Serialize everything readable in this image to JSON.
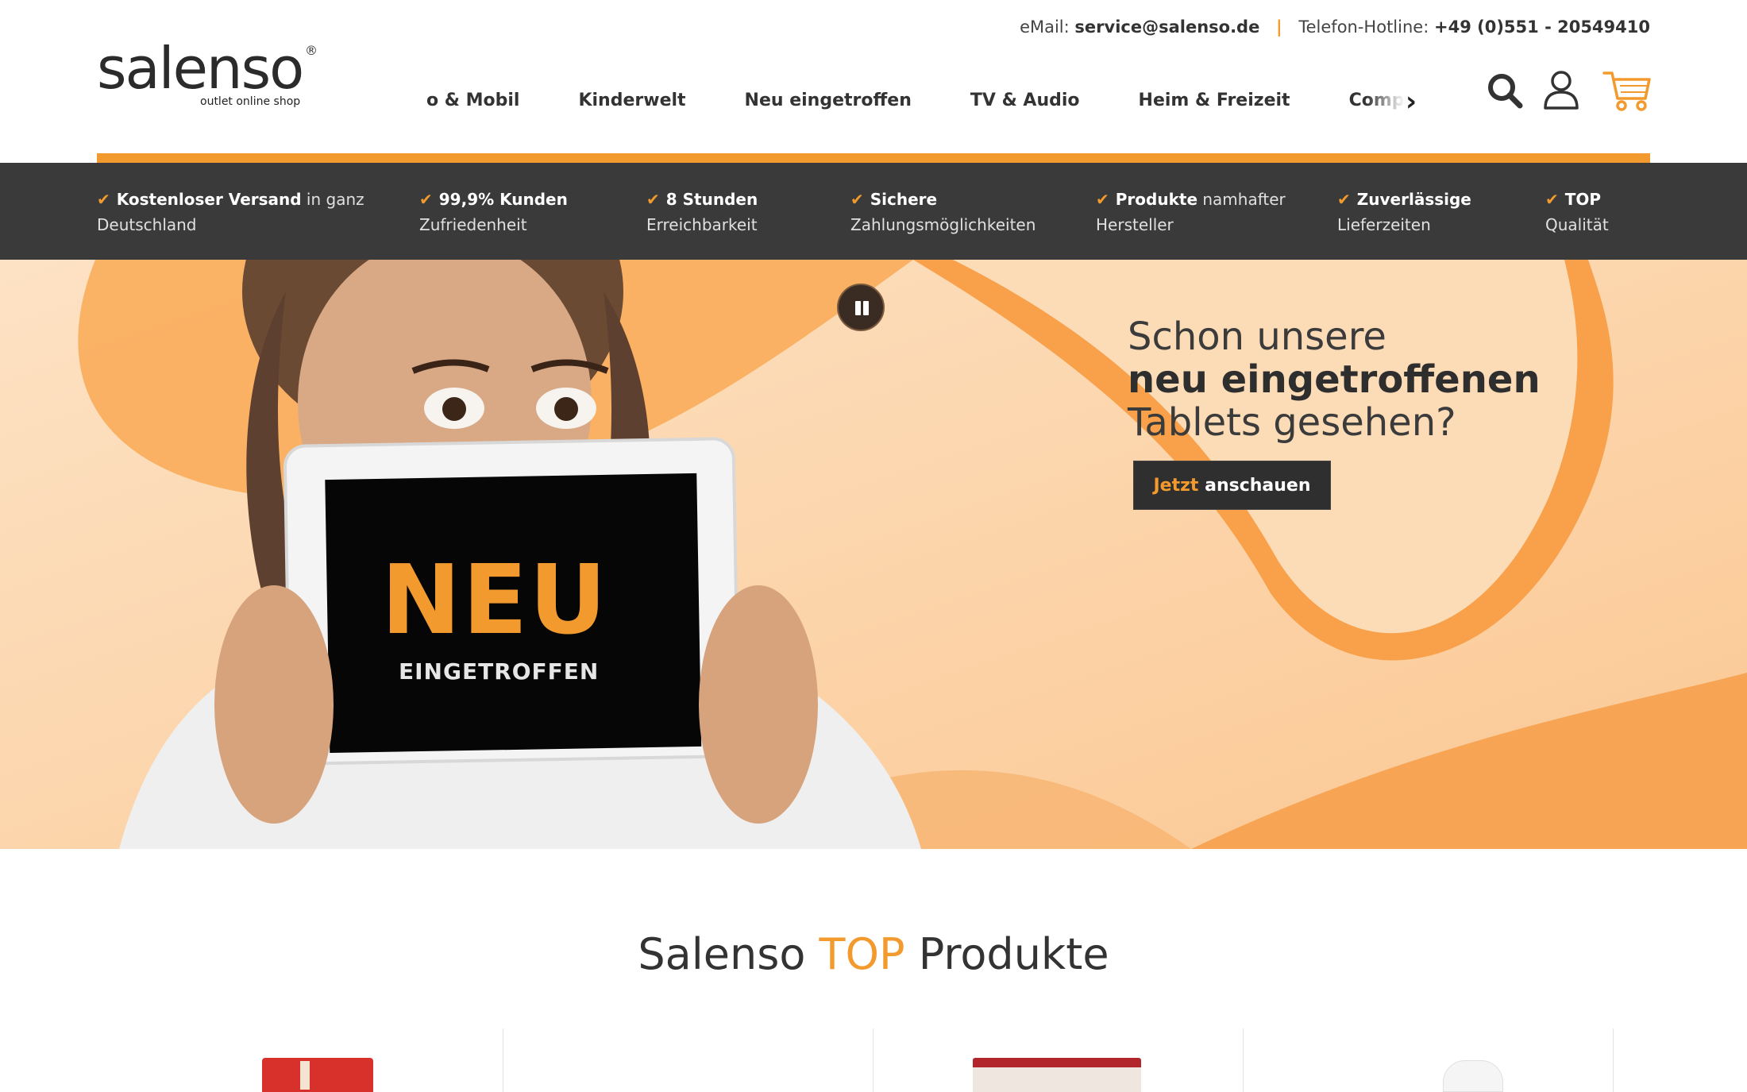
{
  "contact": {
    "email_label": "eMail:",
    "email": "service@salenso.de",
    "separator": "|",
    "phone_label": "Telefon-Hotline:",
    "phone": "+49 (0)551 - 20549410"
  },
  "logo": {
    "word": "salenso",
    "registered": "®",
    "tagline": "outlet online shop"
  },
  "nav": {
    "items": [
      {
        "label": "o & Mobil"
      },
      {
        "label": "Kinderwelt"
      },
      {
        "label": "Neu eingetroffen"
      },
      {
        "label": "TV & Audio"
      },
      {
        "label": "Heim & Freizeit"
      },
      {
        "label": "Computer & Gaming"
      }
    ],
    "next_icon": "chevron-right-icon"
  },
  "header_icons": [
    "search-icon",
    "user-icon",
    "cart-icon"
  ],
  "usp": [
    {
      "bold": "Kostenloser Versand",
      "rest": " in ganz",
      "line2": "Deutschland"
    },
    {
      "bold": "99,9% Kunden",
      "rest": "",
      "line2": "Zufriedenheit"
    },
    {
      "bold": "8 Stunden",
      "rest": "",
      "line2": "Erreichbarkeit"
    },
    {
      "bold": "Sichere",
      "rest": "",
      "line2": "Zahlungsmöglichkeiten"
    },
    {
      "bold": "Produkte",
      "rest": " namhafter",
      "line2": "Hersteller"
    },
    {
      "bold": "Zuverlässige",
      "rest": "",
      "line2": "Lieferzeiten"
    },
    {
      "bold": "TOP",
      "rest": "",
      "line2": "Qualität"
    }
  ],
  "hero": {
    "line1": "Schon unsere",
    "line2": "neu eingetroffenen",
    "line3": "Tablets gesehen?",
    "cta_accent": "Jetzt",
    "cta_rest": " anschauen",
    "tablet_big": "NEU",
    "tablet_small": "EINGETROFFEN"
  },
  "section": {
    "title_a": "Salenso ",
    "title_b": "TOP",
    "title_c": " Produkte"
  },
  "colors": {
    "accent": "#f39a2e",
    "dark_strip": "#3a3a3a",
    "text": "#333333"
  }
}
